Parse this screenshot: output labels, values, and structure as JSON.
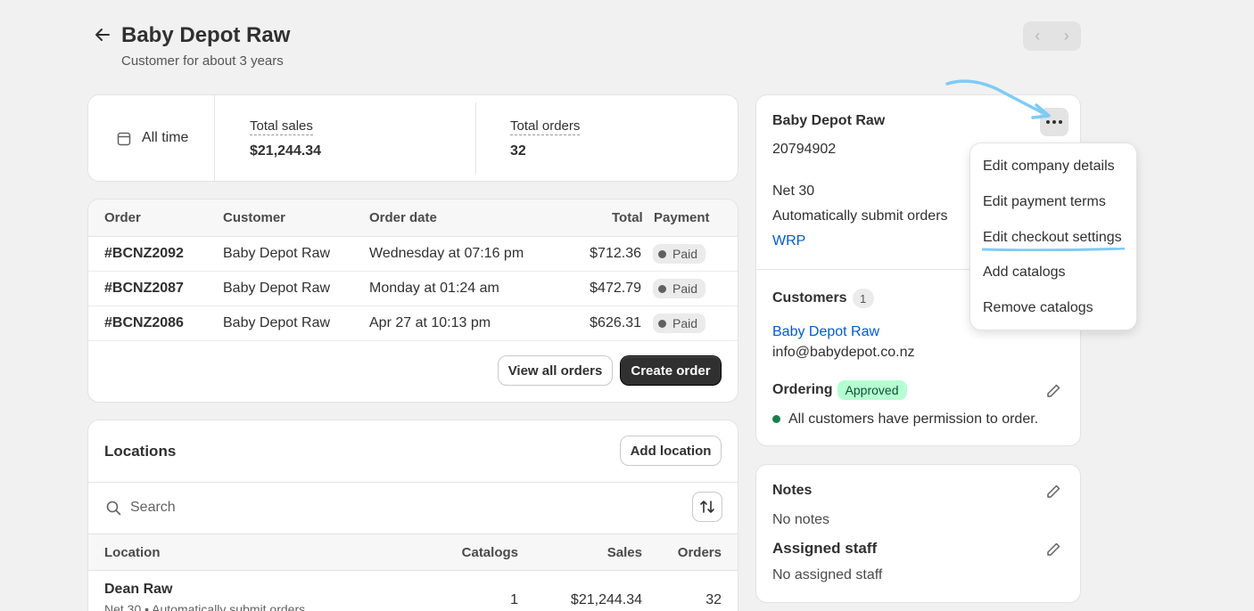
{
  "header": {
    "title": "Baby Depot Raw",
    "subtitle": "Customer for about 3 years",
    "pager_prev": "‹",
    "pager_next": "›"
  },
  "stats": {
    "period": "All time",
    "total_sales_label": "Total sales",
    "total_sales_value": "$21,244.34",
    "total_orders_label": "Total orders",
    "total_orders_value": "32"
  },
  "orders": {
    "columns": [
      "Order",
      "Customer",
      "Order date",
      "Total",
      "Payment"
    ],
    "rows": [
      {
        "order": "#BCNZ2092",
        "customer": "Baby Depot Raw",
        "date": "Wednesday at 07:16 pm",
        "total": "$712.36",
        "payment": "Paid"
      },
      {
        "order": "#BCNZ2087",
        "customer": "Baby Depot Raw",
        "date": "Monday at 01:24 am",
        "total": "$472.79",
        "payment": "Paid"
      },
      {
        "order": "#BCNZ2086",
        "customer": "Baby Depot Raw",
        "date": "Apr 27 at 10:13 pm",
        "total": "$626.31",
        "payment": "Paid"
      }
    ],
    "view_all": "View all orders",
    "create": "Create order"
  },
  "locations": {
    "title": "Locations",
    "add_button": "Add location",
    "search_placeholder": "Search",
    "columns": [
      "Location",
      "Catalogs",
      "Sales",
      "Orders"
    ],
    "rows": [
      {
        "name": "Dean Raw",
        "detail": "Net 30 • Automatically submit orders",
        "catalogs": "1",
        "sales": "$21,244.34",
        "orders": "32"
      }
    ]
  },
  "company": {
    "name": "Baby Depot Raw",
    "id": "20794902",
    "terms": "Net 30",
    "submit": "Automatically submit orders",
    "catalog_link": "WRP",
    "customers_label": "Customers",
    "customers_count": "1",
    "customer_name": "Baby Depot Raw",
    "customer_email": "info@babydepot.co.nz",
    "ordering_label": "Ordering",
    "ordering_status": "Approved",
    "permission_text": "All customers have permission to order."
  },
  "notes": {
    "title": "Notes",
    "text": "No notes",
    "staff_title": "Assigned staff",
    "staff_text": "No assigned staff"
  },
  "menu": {
    "items": [
      "Edit company details",
      "Edit payment terms",
      "Edit checkout settings",
      "Add catalogs",
      "Remove catalogs"
    ]
  },
  "colors": {
    "annotation": "#7ecbf5",
    "link": "#005bd3",
    "approved_bg": "#b4fed2"
  }
}
